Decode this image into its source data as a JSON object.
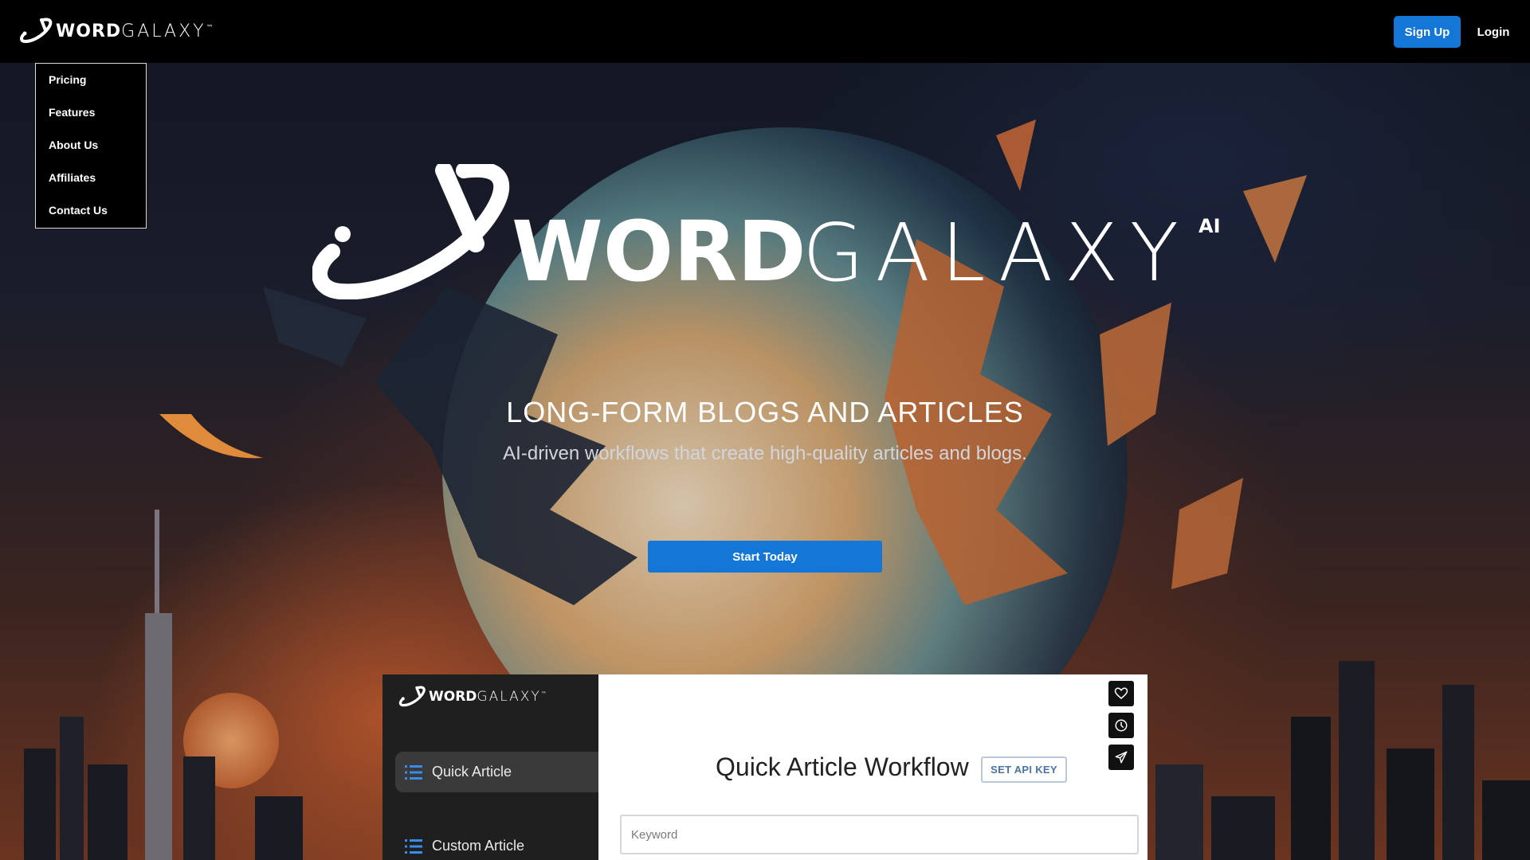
{
  "nav": {
    "brand_word": "WORD",
    "brand_galaxy": "GALAXY",
    "brand_tm": "™",
    "signup_label": "Sign Up",
    "login_label": "Login"
  },
  "menu": {
    "items": [
      {
        "label": "Pricing"
      },
      {
        "label": "Features"
      },
      {
        "label": "About Us"
      },
      {
        "label": "Affiliates"
      },
      {
        "label": "Contact Us"
      }
    ]
  },
  "hero": {
    "logo_word": "WORD",
    "logo_galaxy": "GALAXY",
    "logo_ai": "AI",
    "title": "LONG-FORM BLOGS AND ARTICLES",
    "subtitle": "AI-driven workflows that create high-quality articles and blogs.",
    "cta_label": "Start Today"
  },
  "preview": {
    "brand_word": "WORD",
    "brand_galaxy": "GALAXY",
    "brand_tm": "™",
    "sidebar_items": [
      {
        "label": "Quick Article",
        "active": true
      },
      {
        "label": "Custom Article",
        "active": false
      }
    ],
    "title": "Quick Article Workflow",
    "api_key_label": "SET API KEY",
    "keyword_placeholder": "Keyword",
    "tools": [
      "heart-icon",
      "clock-icon",
      "send-icon"
    ]
  },
  "colors": {
    "accent": "#1476d6",
    "topbar": "#000000",
    "preview_sidebar": "#1f1f1f"
  }
}
